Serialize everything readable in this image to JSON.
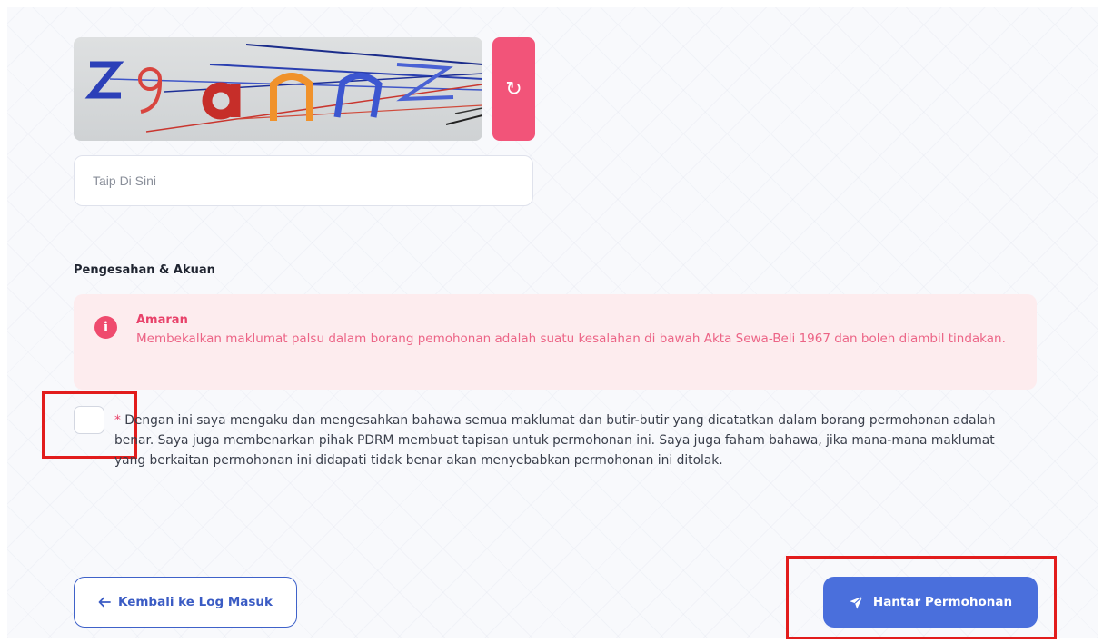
{
  "captcha": {
    "image_text": "z9annz",
    "refresh_icon": "refresh-icon",
    "input_placeholder": "Taip Di Sini",
    "input_value": ""
  },
  "declaration_section": {
    "title": "Pengesahan & Akuan",
    "warning": {
      "icon": "info-icon",
      "title": "Amaran",
      "text": "Membekalkan maklumat palsu dalam borang pemohonan adalah suatu kesalahan di bawah Akta Sewa-Beli 1967 dan boleh diambil tindakan."
    },
    "checkbox_checked": false,
    "required_marker": "*",
    "statement": "Dengan ini saya mengaku dan mengesahkan bahawa semua maklumat dan butir-butir yang dicatatkan dalam borang permohonan adalah benar. Saya juga membenarkan pihak PDRM membuat tapisan untuk permohonan ini. Saya juga faham bahawa, jika mana-mana maklumat yang berkaitan permohonan ini didapati tidak benar akan menyebabkan permohonan ini ditolak."
  },
  "buttons": {
    "back_label": "Kembali ke Log Masuk",
    "back_icon": "arrow-left-icon",
    "submit_label": "Hantar Permohonan",
    "submit_icon": "paper-plane-icon"
  },
  "colors": {
    "accent_pink": "#f25479",
    "primary_blue": "#4a6fdc",
    "warning_bg": "#fdecee",
    "warning_text": "#ec6486",
    "highlight_red": "#e21c1c"
  }
}
